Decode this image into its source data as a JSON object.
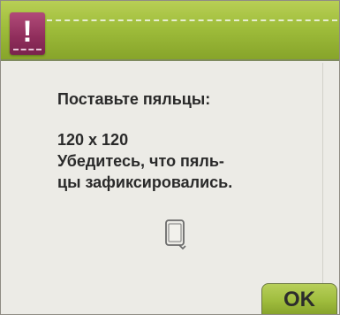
{
  "dialog": {
    "header": {
      "warning_icon": "exclamation-icon",
      "warning_symbol": "!"
    },
    "message": {
      "line1": "Поставьте пяльцы:",
      "line2": "120 x 120",
      "line3": "Убедитесь, что пяль-",
      "line4": "цы зафиксировались."
    },
    "hoop_icon": "embroidery-hoop-icon",
    "ok_label": "OK"
  },
  "colors": {
    "header_green": "#9fbd3b",
    "warning_magenta": "#8f2d5b",
    "background": "#ecebe6",
    "text": "#2a2a2a"
  }
}
